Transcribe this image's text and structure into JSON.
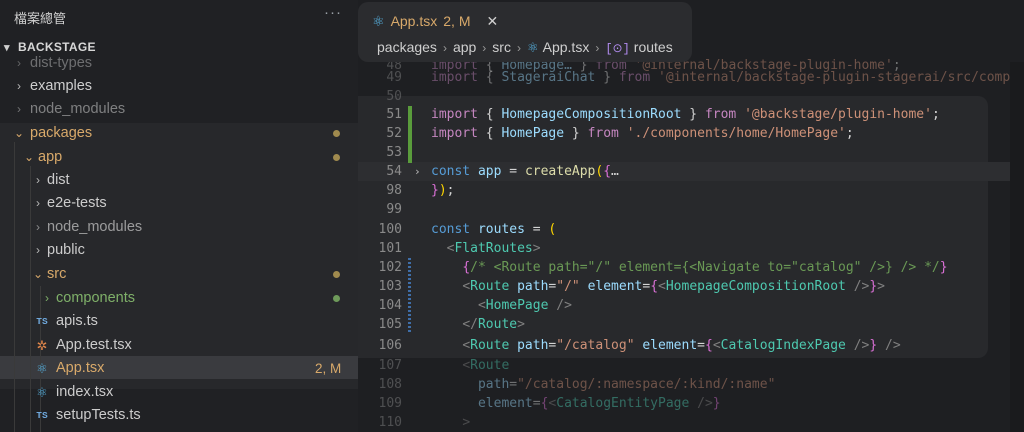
{
  "explorer": {
    "title": "檔案總管",
    "more": "···",
    "section": "BACKSTAGE",
    "items": [
      {
        "label": "dist-types",
        "kind": "folder",
        "open": false
      },
      {
        "label": "examples",
        "kind": "folder",
        "open": false
      },
      {
        "label": "node_modules",
        "kind": "folder",
        "open": false
      },
      {
        "label": "packages",
        "kind": "folder",
        "open": true
      },
      {
        "label": "app",
        "kind": "folder",
        "open": true
      },
      {
        "label": "dist",
        "kind": "folder",
        "open": false
      },
      {
        "label": "e2e-tests",
        "kind": "folder",
        "open": false
      },
      {
        "label": "node_modules",
        "kind": "folder",
        "open": false
      },
      {
        "label": "public",
        "kind": "folder",
        "open": false
      },
      {
        "label": "src",
        "kind": "folder",
        "open": true
      },
      {
        "label": "components",
        "kind": "folder",
        "open": false
      },
      {
        "label": "apis.ts",
        "kind": "ts"
      },
      {
        "label": "App.test.tsx",
        "kind": "test"
      },
      {
        "label": "App.tsx",
        "kind": "react",
        "badge": "2, M"
      },
      {
        "label": "index.tsx",
        "kind": "react"
      },
      {
        "label": "setupTests.ts",
        "kind": "ts"
      }
    ],
    "ts_label": "TS"
  },
  "tab": {
    "name": "App.tsx",
    "badge": "2, M",
    "close": "✕"
  },
  "breadcrumb": [
    "packages",
    "app",
    "src",
    "App.tsx",
    "routes"
  ],
  "editor": {
    "lines": [
      {
        "n": "48",
        "text": "import { Homepage… } from '@internal/backstage-plugin-home';"
      },
      {
        "n": "49",
        "text": "import { StageraiChat } from '@internal/backstage-plugin-stagerai/src/compone"
      },
      {
        "n": "50",
        "text": ""
      },
      {
        "n": "51",
        "text": "import { HomepageCompositionRoot } from '@backstage/plugin-home';"
      },
      {
        "n": "52",
        "text": "import { HomePage } from './components/home/HomePage';"
      },
      {
        "n": "53",
        "text": ""
      },
      {
        "n": "54",
        "text": "const app = createApp({…"
      },
      {
        "n": "98",
        "text": "});"
      },
      {
        "n": "99",
        "text": ""
      },
      {
        "n": "100",
        "text": "const routes = ("
      },
      {
        "n": "101",
        "text": "  <FlatRoutes>"
      },
      {
        "n": "102",
        "text": "    {/* <Route path=\"/\" element={<Navigate to=\"catalog\" />} /> */}"
      },
      {
        "n": "103",
        "text": "    <Route path=\"/\" element={<HomepageCompositionRoot />}>"
      },
      {
        "n": "104",
        "text": "      <HomePage />"
      },
      {
        "n": "105",
        "text": "    </Route>"
      },
      {
        "n": "106",
        "text": "    <Route path=\"/catalog\" element={<CatalogIndexPage />} />"
      },
      {
        "n": "107",
        "text": "    <Route"
      },
      {
        "n": "108",
        "text": "      path=\"/catalog/:namespace/:kind/:name\""
      },
      {
        "n": "109",
        "text": "      element={<CatalogEntityPage />}"
      },
      {
        "n": "110",
        "text": "    >"
      }
    ]
  },
  "colors": {
    "modified": "#d8a96a",
    "added": "#5a9c3c",
    "dot": "#a08a4e",
    "green_dot": "#6e9a5a"
  }
}
